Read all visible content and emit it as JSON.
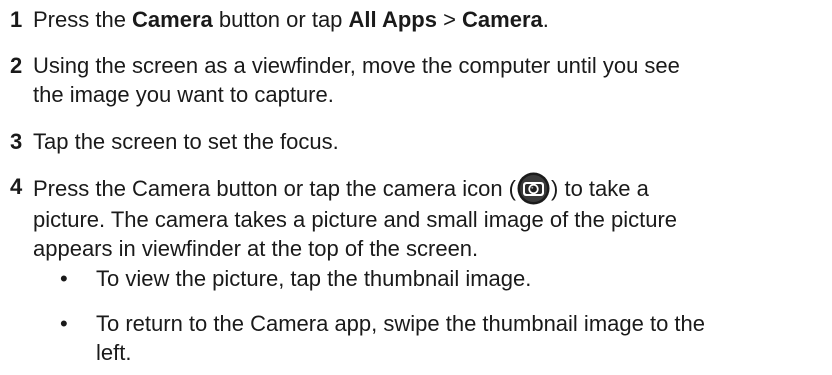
{
  "steps": [
    {
      "number": "1",
      "parts": [
        "Press the ",
        "Camera",
        " button or tap ",
        "All Apps",
        " > ",
        "Camera",
        "."
      ]
    },
    {
      "number": "2",
      "line1": "Using the screen as a viewfinder, move the computer until you see",
      "line2": "the image you want to capture."
    },
    {
      "number": "3",
      "text": "Tap the screen to set the focus."
    },
    {
      "number": "4",
      "pre_icon": "Press the Camera button or tap the camera icon (",
      "post_icon": ") to take a",
      "line2": "picture. The camera takes a picture and small image of the picture",
      "line3": "appears in viewfinder at the top of the screen.",
      "icon": "camera-icon"
    }
  ],
  "bullets": [
    {
      "symbol": "•",
      "text": "To view the picture, tap the thumbnail image."
    },
    {
      "symbol": "•",
      "line1": "To return to the Camera app, swipe the thumbnail image to the",
      "line2": "left."
    }
  ]
}
